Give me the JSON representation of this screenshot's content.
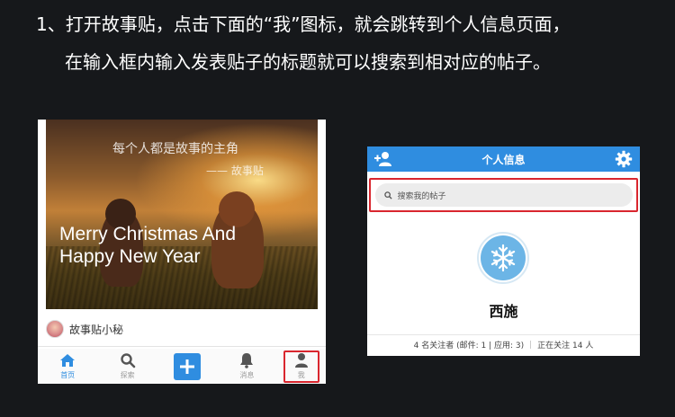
{
  "instructions": {
    "line1": "1、打开故事贴，点击下面的“我”图标，就会跳转到个人信息页面，",
    "line2": "在输入框内输入发表贴子的标题就可以搜索到相对应的帖子。"
  },
  "left_phone": {
    "card": {
      "quote": "每个人都是故事的主角",
      "attribution": "—— 故事贴",
      "title_line1": "Merry Christmas And",
      "title_line2": "Happy New Year"
    },
    "author_name": "故事贴小秘",
    "tabs": [
      {
        "label": "首页",
        "icon": "home-icon"
      },
      {
        "label": "探索",
        "icon": "search-icon"
      },
      {
        "label": "",
        "icon": "plus-icon"
      },
      {
        "label": "消息",
        "icon": "bell-icon"
      },
      {
        "label": "我",
        "icon": "person-icon"
      }
    ],
    "active_tab": "首页",
    "highlighted_tab": "我",
    "accent_color": "#2f8de0",
    "highlight_color": "#d9262e"
  },
  "right_phone": {
    "header_title": "个人信息",
    "search_placeholder": "搜索我的帖子",
    "profile_name": "西施",
    "stats_followers": "4 名关注者 (邮件: 1 | 应用: 3)",
    "stats_following": "正在关注 14 人",
    "header_color": "#2f8de0"
  }
}
